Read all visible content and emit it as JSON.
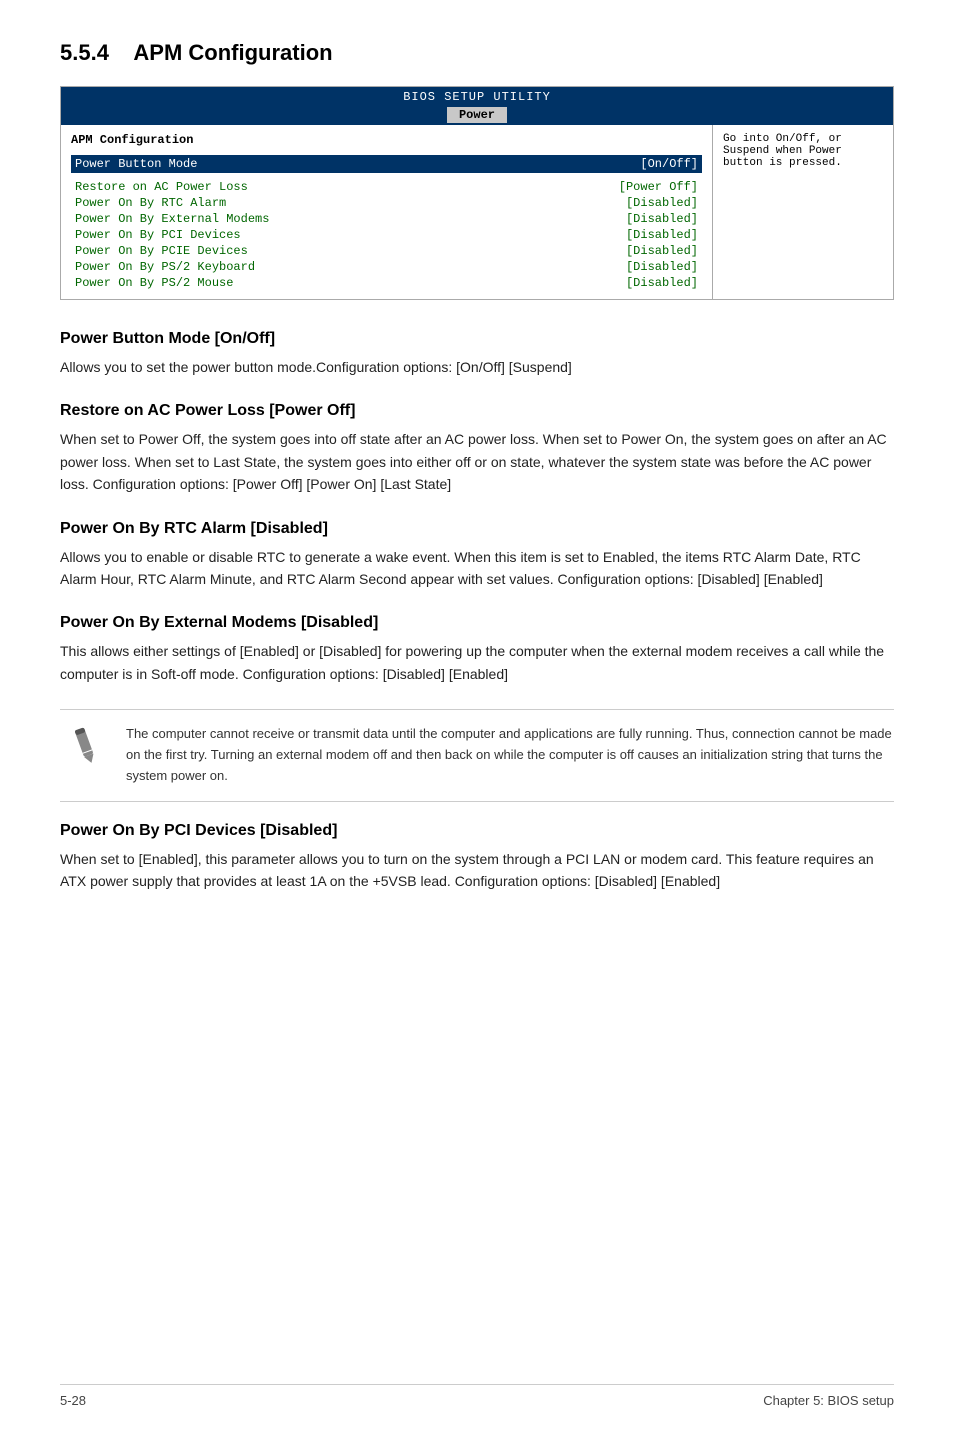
{
  "section": {
    "number": "5.5.4",
    "title": "APM Configuration"
  },
  "bios": {
    "title": "BIOS SETUP UTILITY",
    "active_tab": "Power",
    "section_label": "APM Configuration",
    "highlighted_row": {
      "label": "Power Button Mode",
      "value": "[On/Off]"
    },
    "rows": [
      {
        "label": "Restore on AC Power Loss",
        "value": "[Power Off]"
      },
      {
        "label": "Power On By RTC Alarm",
        "value": "[Disabled]"
      },
      {
        "label": "Power On By External Modems",
        "value": "[Disabled]"
      },
      {
        "label": "Power On By PCI Devices",
        "value": "[Disabled]"
      },
      {
        "label": "Power On By PCIE Devices",
        "value": "[Disabled]"
      },
      {
        "label": "Power On By PS/2 Keyboard",
        "value": "[Disabled]"
      },
      {
        "label": "Power On By PS/2 Mouse",
        "value": "[Disabled]"
      }
    ],
    "sidebar_text": "Go into On/Off, or Suspend when Power button is pressed."
  },
  "subsections": [
    {
      "id": "power-button-mode",
      "heading": "Power Button Mode [On/Off]",
      "body": "Allows you to set the power button mode.Configuration options: [On/Off] [Suspend]"
    },
    {
      "id": "restore-ac-power-loss",
      "heading": "Restore on AC Power Loss [Power Off]",
      "body": "When set to Power Off, the system goes into off state after an AC power loss. When set to Power On, the system goes on after an AC power loss. When set to Last State, the system goes into either off or on state, whatever the system state was before the AC power loss. Configuration options: [Power Off] [Power On] [Last State]"
    },
    {
      "id": "power-on-rtc-alarm",
      "heading": "Power On By RTC Alarm [Disabled]",
      "body": "Allows you to enable or disable RTC to generate a wake event. When this item is set to Enabled, the items RTC Alarm Date, RTC Alarm Hour, RTC Alarm Minute, and RTC Alarm Second appear with set values. Configuration options: [Disabled] [Enabled]"
    },
    {
      "id": "power-on-external-modems",
      "heading": "Power On By External Modems [Disabled]",
      "body": "This allows either settings of [Enabled] or [Disabled] for powering up the computer when the external modem receives a call while the computer is in Soft-off mode. Configuration options: [Disabled] [Enabled]"
    },
    {
      "id": "power-on-pci-devices",
      "heading": "Power On By PCI Devices [Disabled]",
      "body": "When set to [Enabled], this parameter allows you to turn on the system through a PCI LAN or modem card. This feature requires an ATX power supply that provides at least 1A on the +5VSB lead. Configuration options: [Disabled] [Enabled]"
    }
  ],
  "note": {
    "text": "The computer cannot receive or transmit data until the computer and applications are fully running. Thus, connection cannot be made on the first try. Turning an external modem off and then back on while the computer is off causes an initialization string that turns the system power on."
  },
  "footer": {
    "left": "5-28",
    "right": "Chapter 5: BIOS setup"
  }
}
